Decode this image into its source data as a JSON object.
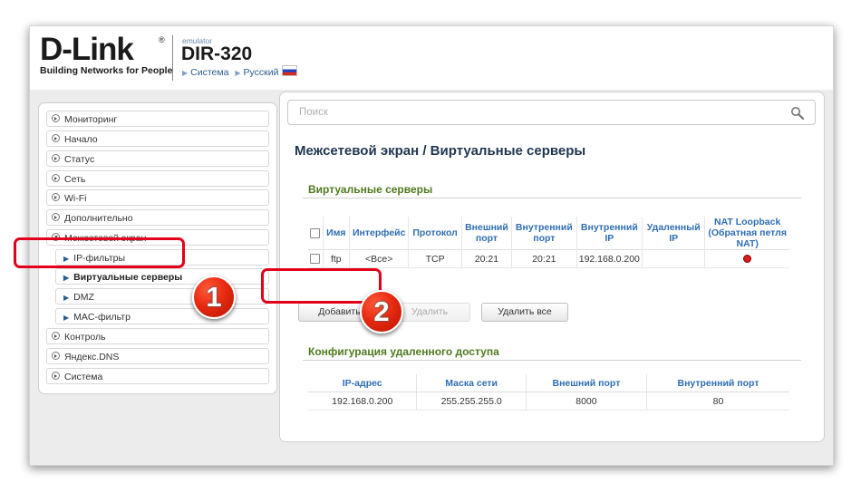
{
  "header": {
    "logo": "D-Link",
    "logo_reg": "®",
    "tagline": "Building Networks for People",
    "emulator": "emulator",
    "model": "DIR-320",
    "crumb_system": "Система",
    "crumb_language": "Русский"
  },
  "sidebar": {
    "items": [
      {
        "label": "Мониторинг"
      },
      {
        "label": "Начало"
      },
      {
        "label": "Статус"
      },
      {
        "label": "Сеть"
      },
      {
        "label": "Wi-Fi"
      },
      {
        "label": "Дополнительно"
      },
      {
        "label": "Межсетевой экран"
      },
      {
        "label": "IP-фильтры"
      },
      {
        "label": "Виртуальные серверы"
      },
      {
        "label": "DMZ"
      },
      {
        "label": "MAC-фильтр"
      },
      {
        "label": "Контроль"
      },
      {
        "label": "Яндекс.DNS"
      },
      {
        "label": "Система"
      }
    ]
  },
  "search": {
    "placeholder": "Поиск"
  },
  "page_title": "Межсетевой экран /  Виртуальные серверы",
  "virtual_servers": {
    "title": "Виртуальные серверы",
    "columns": [
      "Имя",
      "Интерфейс",
      "Протокол",
      "Внешний порт",
      "Внутренний порт",
      "Внутренний IP",
      "Удаленный IP",
      "NAT Loopback (Обратная петля NAT)"
    ],
    "rows": [
      {
        "name": "ftp",
        "interface": "<Все>",
        "protocol": "TCP",
        "ext_port": "20:21",
        "int_port": "20:21",
        "int_ip": "192.168.0.200",
        "remote_ip": "",
        "nat_loopback": "off"
      }
    ],
    "buttons": {
      "add": "Добавить",
      "delete": "Удалить",
      "delete_all": "Удалить все"
    }
  },
  "remote_config": {
    "title": "Конфигурация удаленного доступа",
    "columns": [
      "IP-адрес",
      "Маска сети",
      "Внешний порт",
      "Внутренний порт"
    ],
    "rows": [
      {
        "ip": "192.168.0.200",
        "mask": "255.255.255.0",
        "ext_port": "8000",
        "int_port": "80"
      }
    ]
  },
  "annotations": {
    "badge1": "1",
    "badge2": "2",
    "highlight_color": "#e2001a"
  }
}
